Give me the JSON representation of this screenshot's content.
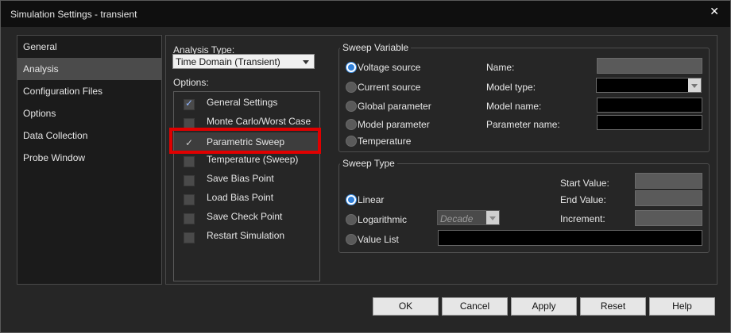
{
  "window": {
    "title": "Simulation Settings - transient",
    "close_glyph": "✕"
  },
  "nav": [
    {
      "label": "General",
      "active": false
    },
    {
      "label": "Analysis",
      "active": true
    },
    {
      "label": "Configuration Files",
      "active": false
    },
    {
      "label": "Options",
      "active": false
    },
    {
      "label": "Data Collection",
      "active": false
    },
    {
      "label": "Probe Window",
      "active": false
    }
  ],
  "analysis": {
    "type_label": "Analysis Type:",
    "type_value": "Time Domain (Transient)",
    "options_label": "Options:",
    "options": [
      {
        "label": "General Settings",
        "checked": true
      },
      {
        "label": "Monte Carlo/Worst Case",
        "checked": false
      },
      {
        "label": "Parametric Sweep",
        "checked": true,
        "selected": true
      },
      {
        "label": "Temperature (Sweep)",
        "checked": false
      },
      {
        "label": "Save Bias Point",
        "checked": false
      },
      {
        "label": "Load Bias Point",
        "checked": false
      },
      {
        "label": "Save Check Point",
        "checked": false
      },
      {
        "label": "Restart Simulation",
        "checked": false
      }
    ]
  },
  "sweep_variable": {
    "title": "Sweep Variable",
    "radios": [
      {
        "label": "Voltage source",
        "selected": true
      },
      {
        "label": "Current source",
        "selected": false
      },
      {
        "label": "Global parameter",
        "selected": false
      },
      {
        "label": "Model parameter",
        "selected": false
      },
      {
        "label": "Temperature",
        "selected": false
      }
    ],
    "fields": {
      "name_label": "Name:",
      "model_type_label": "Model type:",
      "model_name_label": "Model name:",
      "parameter_name_label": "Parameter name:",
      "name_value": "",
      "model_type_value": "",
      "model_name_value": "",
      "parameter_name_value": ""
    }
  },
  "sweep_type": {
    "title": "Sweep Type",
    "radios": [
      {
        "label": "Linear",
        "selected": true
      },
      {
        "label": "Logarithmic",
        "selected": false
      },
      {
        "label": "Value List",
        "selected": false
      }
    ],
    "log_scale_value": "Decade",
    "start_label": "Start Value:",
    "end_label": "End Value:",
    "increment_label": "Increment:",
    "start_value": "",
    "end_value": "",
    "increment_value": "",
    "value_list": ""
  },
  "buttons": {
    "ok": "OK",
    "cancel": "Cancel",
    "apply": "Apply",
    "reset": "Reset",
    "help": "Help"
  },
  "colors": {
    "accent": "#2f7fd8",
    "highlight_border": "#e00000",
    "title_bar": "#0f0f0f",
    "panel": "#262626"
  }
}
